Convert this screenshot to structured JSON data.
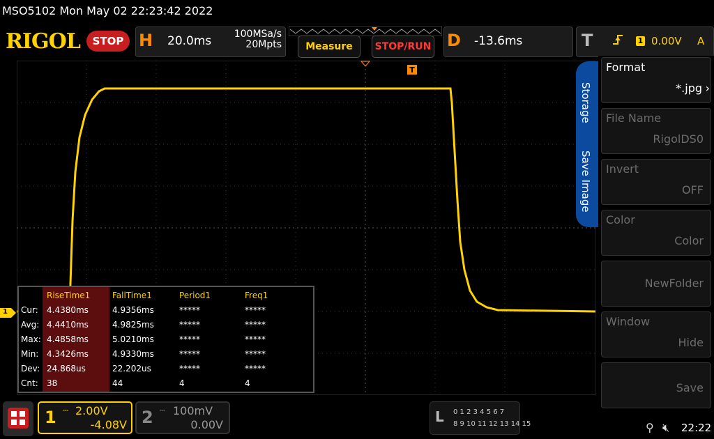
{
  "status": {
    "model_datetime": "MSO5102  Mon May 02 22:23:42 2022"
  },
  "header": {
    "logo": "RIGOL",
    "run_state": "STOP",
    "horizontal": {
      "letter": "H",
      "timebase": "20.0ms",
      "sample_rate": "100MSa/s",
      "memory_depth": "20Mpts"
    },
    "measure_button": "Measure",
    "stop_run_button": "STOP/RUN",
    "delay": {
      "letter": "D",
      "value": "-13.6ms"
    },
    "trigger": {
      "letter": "T",
      "channel": "1",
      "level": "0.00V",
      "mode": "A",
      "edge_icon": "rising-edge-icon"
    }
  },
  "side_menu": {
    "tabs": [
      "Storage",
      "Save Image"
    ],
    "items": [
      {
        "title": "Format",
        "value": "*.jpg",
        "active": true
      },
      {
        "title": "File Name",
        "value": "RigolDS0",
        "active": false
      },
      {
        "title": "Invert",
        "value": "OFF",
        "active": false
      },
      {
        "title": "Color",
        "value": "Color",
        "active": false
      },
      {
        "title": "",
        "value": "NewFolder",
        "active": false
      },
      {
        "title": "Window",
        "value": "Hide",
        "active": false
      },
      {
        "title": "",
        "value": "Save",
        "active": false
      }
    ]
  },
  "ch1_marker": "1",
  "measurements": {
    "columns": [
      "RiseTime1",
      "FallTime1",
      "Period1",
      "Freq1"
    ],
    "rows": [
      {
        "label": "Cur:",
        "values": [
          "4.4380ms",
          "4.9356ms",
          "*****",
          "*****"
        ]
      },
      {
        "label": "Avg:",
        "values": [
          "4.4410ms",
          "4.9825ms",
          "*****",
          "*****"
        ]
      },
      {
        "label": "Max:",
        "values": [
          "4.4858ms",
          "5.0210ms",
          "*****",
          "*****"
        ]
      },
      {
        "label": "Min:",
        "values": [
          "4.3426ms",
          "4.9330ms",
          "*****",
          "*****"
        ]
      },
      {
        "label": "Dev:",
        "values": [
          "24.868us",
          "22.202us",
          "*****",
          "*****"
        ]
      },
      {
        "label": "Cnt:",
        "values": [
          "38",
          "44",
          "4",
          "4"
        ]
      }
    ]
  },
  "channels": [
    {
      "number": "1",
      "scale": "2.00V",
      "offset": "-4.08V",
      "active": true
    },
    {
      "number": "2",
      "scale": "100mV",
      "offset": "0.00V",
      "active": false
    }
  ],
  "logic_analyzer": {
    "letter": "L",
    "row1": "0 1 2 3  4 5 6 7",
    "row2": "8 9 10 11 12 13 14 15"
  },
  "clock": "22:22",
  "colors": {
    "ch1": "#ffd200",
    "menu_tab": "#0c4aa0",
    "stop": "#c71f1f",
    "accent": "#ff8a00"
  }
}
